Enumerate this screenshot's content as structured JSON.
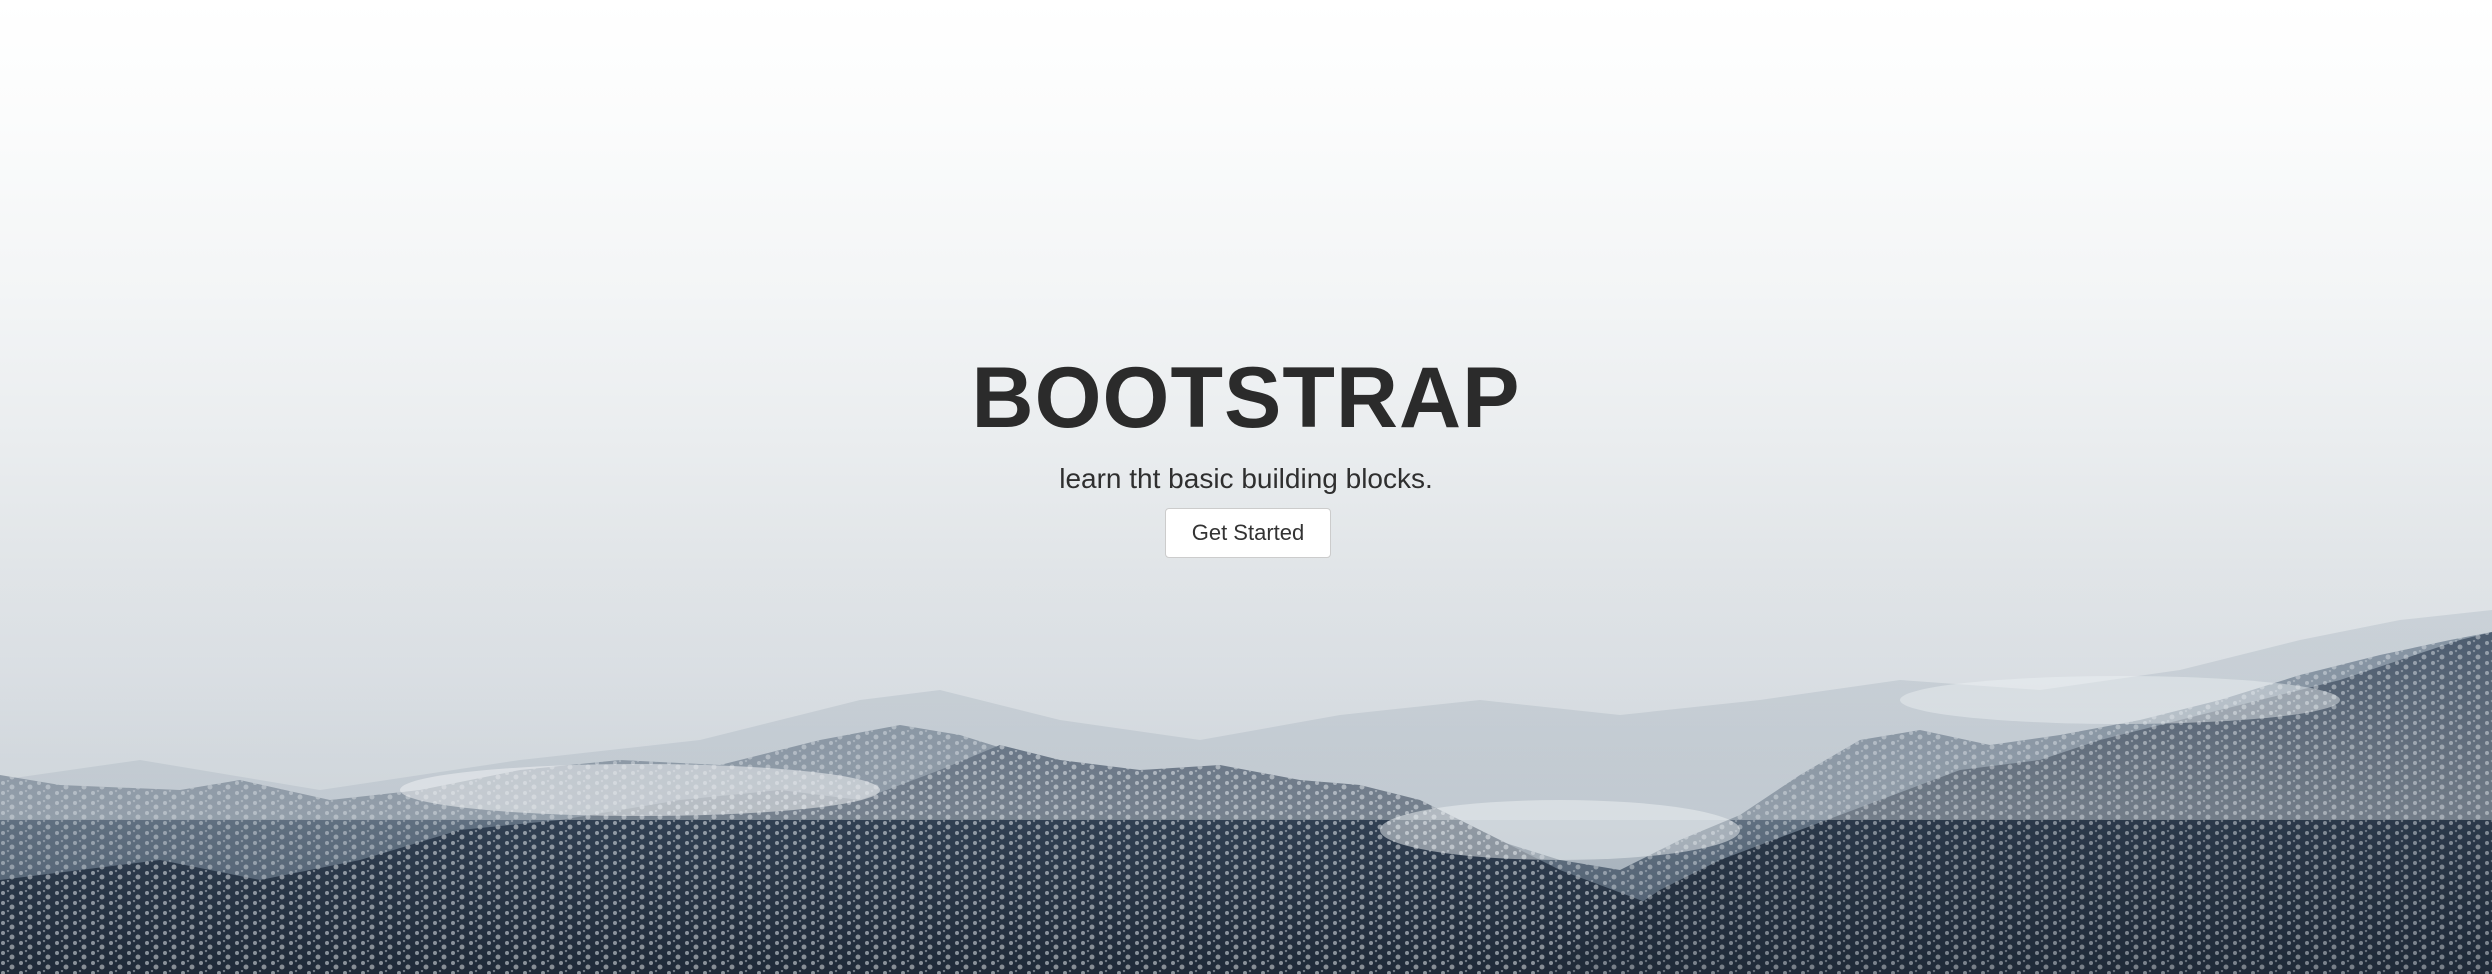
{
  "hero": {
    "title": "BOOTSTRAP",
    "subtitle": "learn tht basic building blocks.",
    "cta_label": "Get Started"
  },
  "colors": {
    "title": "#2b2b2b",
    "button_bg": "#ffffff",
    "button_border": "#cccccc"
  }
}
